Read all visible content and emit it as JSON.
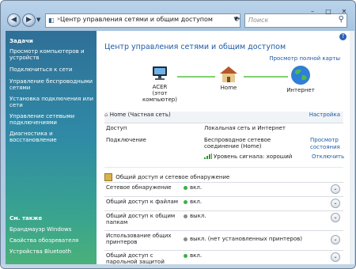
{
  "address": {
    "path": "Центр управления сетями и общим доступом"
  },
  "search": {
    "placeholder": "Поиск"
  },
  "window": {
    "minimize": "–",
    "maximize": "□",
    "close": "✕"
  },
  "sidebar": {
    "tasks_heading": "Задачи",
    "items": [
      "Просмотр компьютеров и устройств",
      "Подключиться к сети",
      "Управление беспроводными сетями",
      "Установка подключения или сети",
      "Управление сетевыми подключениями",
      "Диагностика и восстановление"
    ],
    "see_also_heading": "См. также",
    "see_also": [
      "Брандмауэр Windows",
      "Свойства обозревателя",
      "Устройства Bluetooth"
    ]
  },
  "main": {
    "title": "Центр управления сетями и общим доступом",
    "view_full_map": "Просмотр полной карты",
    "nodes": [
      {
        "label": "ACER",
        "sub": "(этот компьютер)",
        "icon": "computer-icon"
      },
      {
        "label": "Home",
        "sub": "",
        "icon": "home-network-icon"
      },
      {
        "label": "Интернет",
        "sub": "",
        "icon": "globe-icon"
      }
    ],
    "network": {
      "name": "Home",
      "type": "(Частная сеть)",
      "settings": "Настройка",
      "access_label": "Доступ",
      "access_value": "Локальная сеть и Интернет",
      "connection_label": "Подключение",
      "connection_value": "Беспроводное сетевое соединение (Home)",
      "view_status": "Просмотр состояния",
      "signal": "Уровень сигнала: хороший",
      "disconnect": "Отключить"
    },
    "sharing": {
      "heading": "Общий доступ и сетевое обнаружение",
      "rows": [
        {
          "label": "Сетевое обнаружение",
          "value": "вкл.",
          "on": true
        },
        {
          "label": "Общий доступ к файлам",
          "value": "вкл.",
          "on": true
        },
        {
          "label": "Общий доступ к общим папкам",
          "value": "выкл.",
          "on": false
        },
        {
          "label": "Использование общих принтеров",
          "value": "выкл. (нет установленных принтеров)",
          "on": false
        },
        {
          "label": "Общий доступ с парольной защитой",
          "value": "вкл.",
          "on": true
        }
      ]
    }
  },
  "colors": {
    "on": "#3cb043",
    "off": "#8a8a8a",
    "link": "#1e5aa6"
  }
}
